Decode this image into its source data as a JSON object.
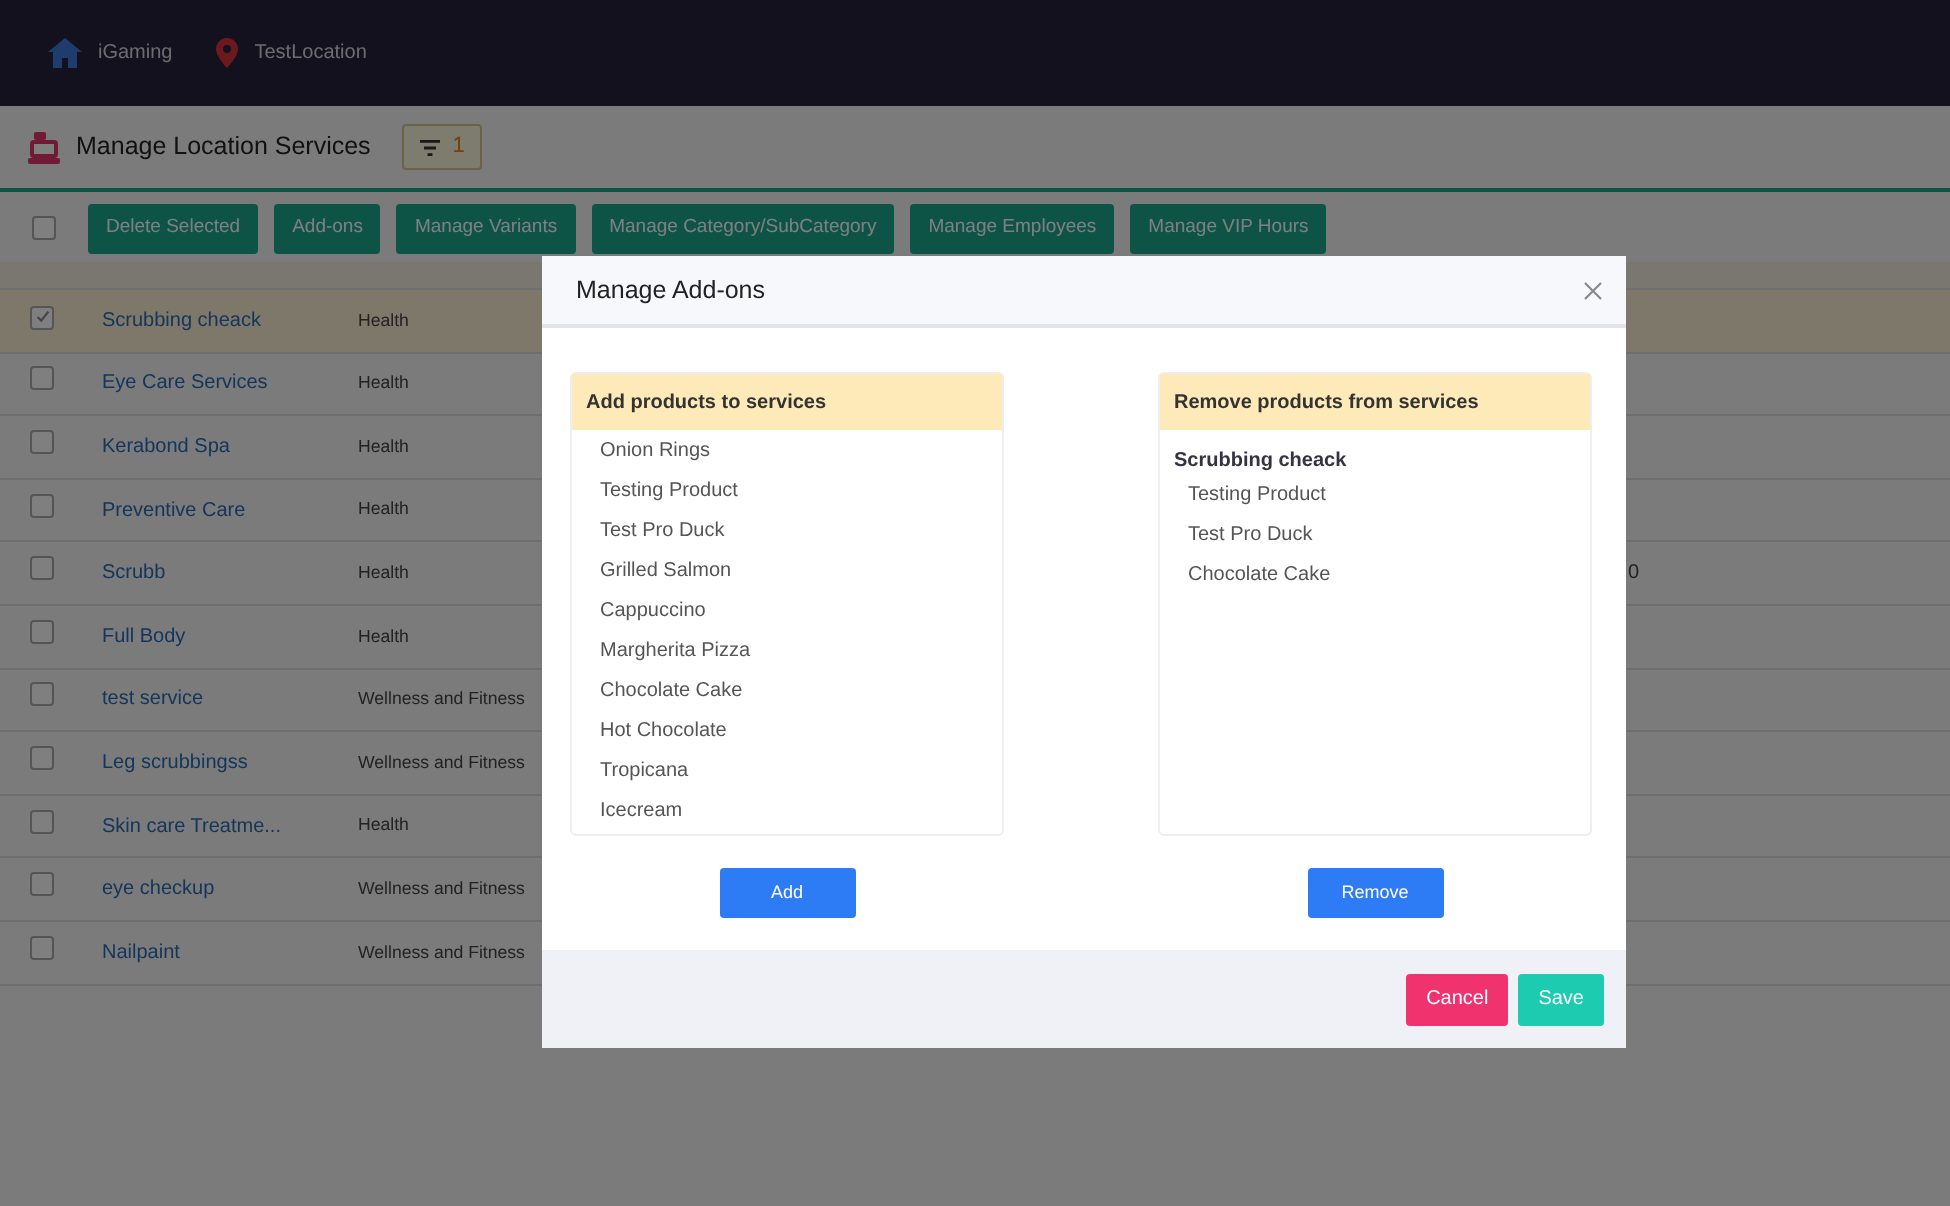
{
  "navbar": {
    "items": [
      {
        "label": "iGaming"
      },
      {
        "label": "TestLocation"
      }
    ]
  },
  "page": {
    "title": "Manage Location Services",
    "filter_count": "1"
  },
  "toolbar": {
    "select_all_checked": false,
    "buttons": [
      "Delete Selected",
      "Add-ons",
      "Manage Variants",
      "Manage Category/SubCategory",
      "Manage Employees",
      "Manage VIP Hours"
    ]
  },
  "table": {
    "rows": [
      {
        "name": "Scrubbing cheack",
        "category": "Health",
        "selected": true,
        "checked": true
      },
      {
        "name": "Eye Care Services",
        "category": "Health",
        "selected": false,
        "checked": false
      },
      {
        "name": "Kerabond Spa",
        "category": "Health",
        "selected": false,
        "checked": false
      },
      {
        "name": "Preventive Care",
        "category": "Health",
        "selected": false,
        "checked": false
      },
      {
        "name": "Scrubb",
        "category": "Health",
        "column_3": "0",
        "selected": false,
        "checked": false
      },
      {
        "name": "Full Body",
        "category": "Health",
        "selected": false,
        "checked": false
      },
      {
        "name": "test service",
        "category": "Wellness and Fitness",
        "selected": false,
        "checked": false
      },
      {
        "name": "Leg scrubbingss",
        "category": "Wellness and Fitness",
        "selected": false,
        "checked": false
      },
      {
        "name": "Skin care Treatme...",
        "category": "Health",
        "selected": false,
        "checked": false
      },
      {
        "name": "eye checkup",
        "category": "Wellness and Fitness",
        "selected": false,
        "checked": false
      },
      {
        "name": "Nailpaint",
        "category": "Wellness and Fitness",
        "selected": false,
        "checked": false
      }
    ]
  },
  "modal": {
    "title": "Manage Add-ons",
    "add_panel": {
      "title": "Add products to services",
      "items": [
        "Onion Rings",
        "Testing Product",
        "Test Pro Duck",
        "Grilled Salmon",
        "Cappuccino",
        "Margherita Pizza",
        "Chocolate Cake",
        "Hot Chocolate",
        "Tropicana",
        "Icecream"
      ],
      "button": "Add"
    },
    "remove_panel": {
      "title": "Remove products from services",
      "service": "Scrubbing cheack",
      "items": [
        "Testing Product",
        "Test Pro Duck",
        "Chocolate Cake"
      ],
      "button": "Remove"
    },
    "footer_buttons": [
      {
        "label": "Cancel",
        "kind": "cancel"
      },
      {
        "label": "Save",
        "kind": "save"
      }
    ]
  }
}
